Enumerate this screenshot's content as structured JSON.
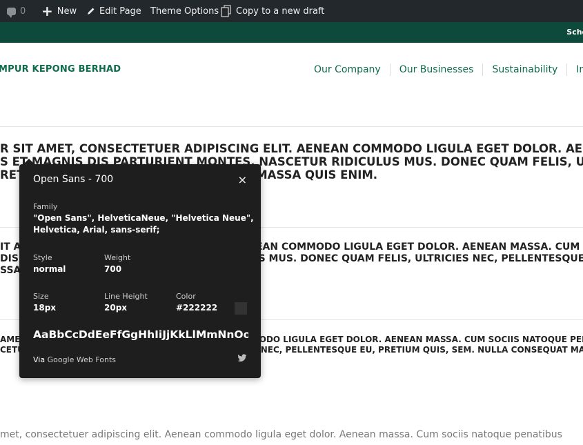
{
  "adminbar": {
    "comments_count": "0",
    "new_label": "New",
    "edit_label": "Edit Page",
    "theme_label": "Theme Options",
    "copy_label": "Copy to a new draft"
  },
  "topbar": {
    "schedule_text": "Sche"
  },
  "header": {
    "logo_text": "MPUR KEPONG BERHAD",
    "nav": [
      "Our Company",
      "Our Businesses",
      "Sustainability",
      "Inv"
    ]
  },
  "specimen": {
    "block1": [
      "R SIT AMET, CONSECTETUER ADIPISCING ELIT. AENEAN COMMODO LIGULA EGET DOLOR. AENEAN MASSA.",
      "S ET MAGNIS DIS PARTURIENT MONTES, NASCETUR RIDICULUS MUS. DONEC QUAM FELIS, ULTRICIES NEC,",
      "RETIUM QUIS, SEM. NULLA CONSEQUAT MASSA QUIS ENIM."
    ],
    "block2": [
      "IT AMET, CONSECTETUER ADIPISCING ELIT. AENEAN COMMODO LIGULA EGET DOLOR. AENEAN MASSA. CUM SOCIIS",
      "DIS PARTURIENT MONTES, NASCETUR RIDICULUS MUS. DONEC QUAM FELIS, ULTRICIES NEC, PELLENTESQUE EU,",
      "SSA QUIS ENIM."
    ],
    "block3": [
      "AMET, CONSECTETUER ADIPISCING ELIT. AENEAN COMMODO LIGULA EGET DOLOR. AENEAN MASSA. CUM SOCIIS NATOQUE PENATIBUS",
      "CETUR RIDICULUS MUS. DONEC QUAM FELIS, ULTRICIES NEC, PELLENTESQUE EU, PRETIUM QUIS, SEM. NULLA CONSEQUAT MASSA"
    ],
    "body": "met, consectetuer adipiscing elit. Aenean commodo ligula eget dolor. Aenean massa. Cum sociis natoque penatibus"
  },
  "popup": {
    "title": "Open Sans - 700",
    "close": "×",
    "family_label": "Family",
    "family_value_1": "\"Open Sans\", HelveticaNeue, \"Helvetica Neue\",",
    "family_value_2": "Helvetica, Arial, sans-serif;",
    "style_label": "Style",
    "style_value": "normal",
    "weight_label": "Weight",
    "weight_value": "700",
    "size_label": "Size",
    "size_value": "18px",
    "lineheight_label": "Line Height",
    "lineheight_value": "20px",
    "color_label": "Color",
    "color_value": "#222222",
    "sample": "AaBbCcDdEeFfGgHhIiJjKkLlMmNnOoPpQqRrSsTt",
    "via_prefix": "Via",
    "via_link": "Google Web Fonts"
  },
  "colors": {
    "adminbar_bg": "#23282d",
    "brand_green": "#0e4a3c",
    "link_green": "#0e6b4b",
    "popup_bg": "#1e1e1e"
  }
}
